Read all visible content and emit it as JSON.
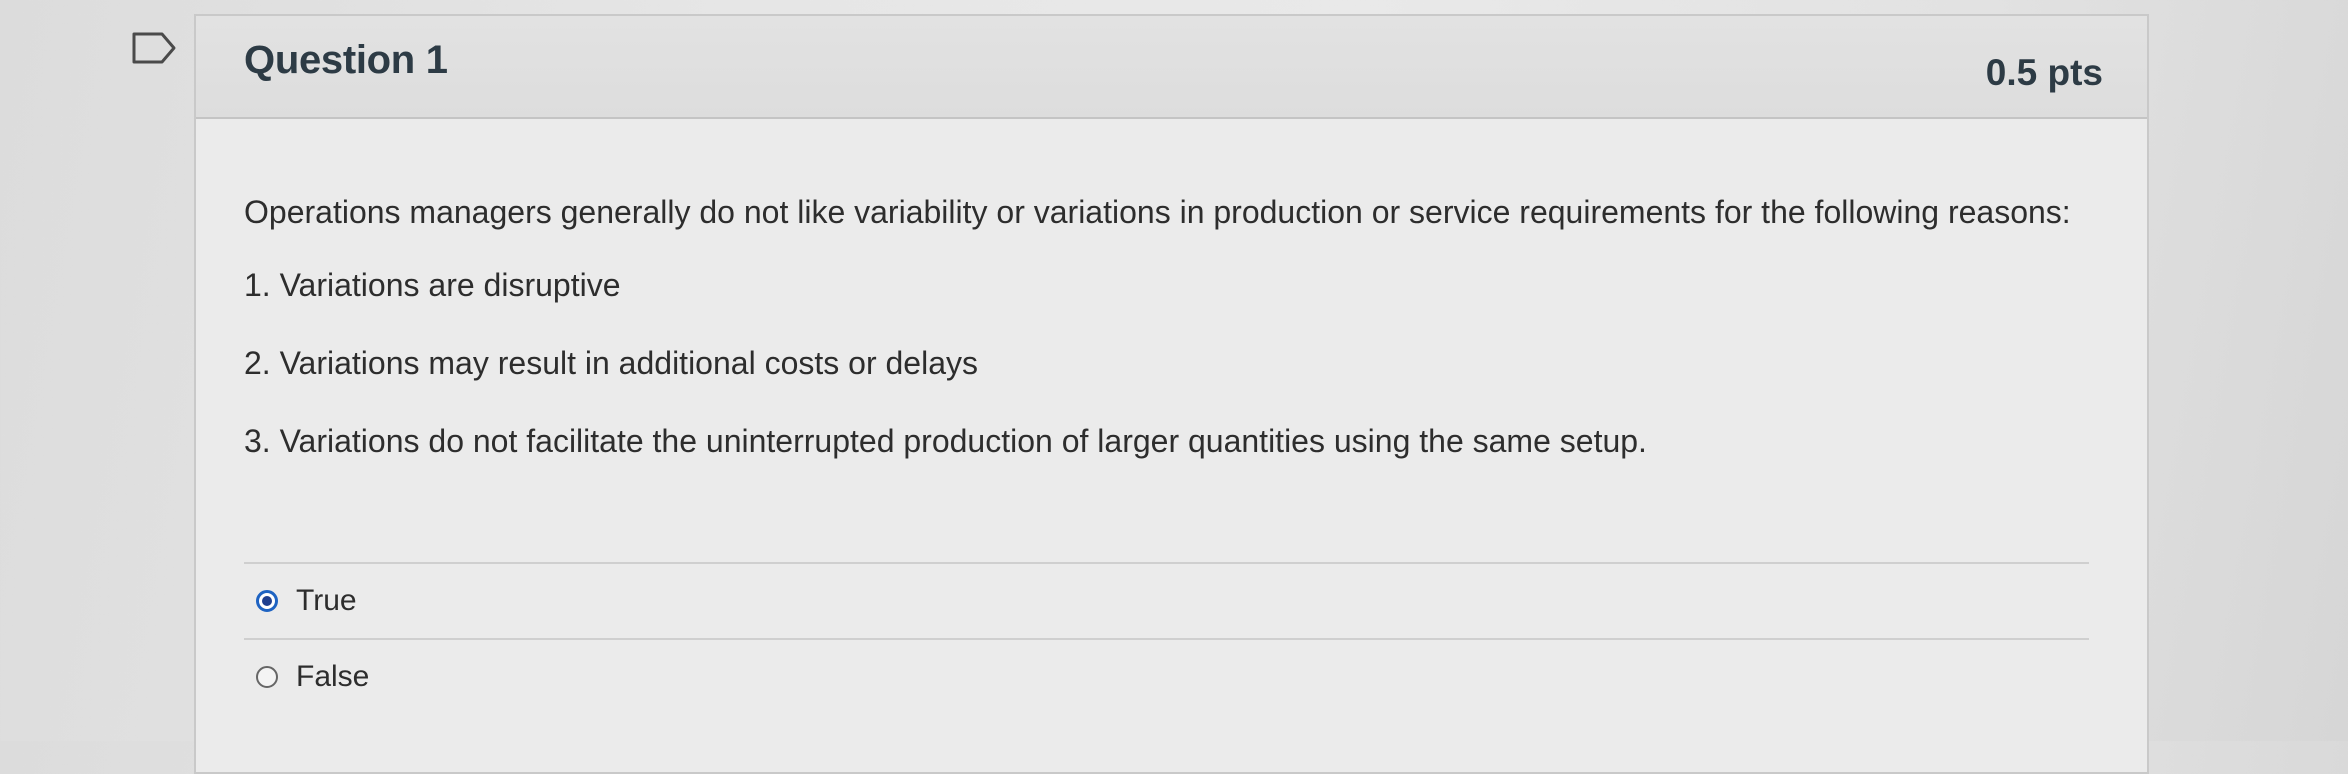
{
  "question": {
    "title": "Question 1",
    "points": "0.5 pts",
    "prompt": "Operations managers generally do not like variability or variations in production or service requirements for the following reasons:",
    "reasons": [
      "1. Variations are disruptive",
      "2. Variations may result in additional costs or delays",
      "3. Variations do not facilitate the uninterrupted production of larger quantities using the same setup."
    ],
    "answers": [
      {
        "label": "True",
        "selected": true
      },
      {
        "label": "False",
        "selected": false
      }
    ]
  },
  "colors": {
    "radio_selected": "#1e63c2",
    "header_text": "#2d3b45"
  },
  "icons": {
    "flag": "flag-icon"
  }
}
